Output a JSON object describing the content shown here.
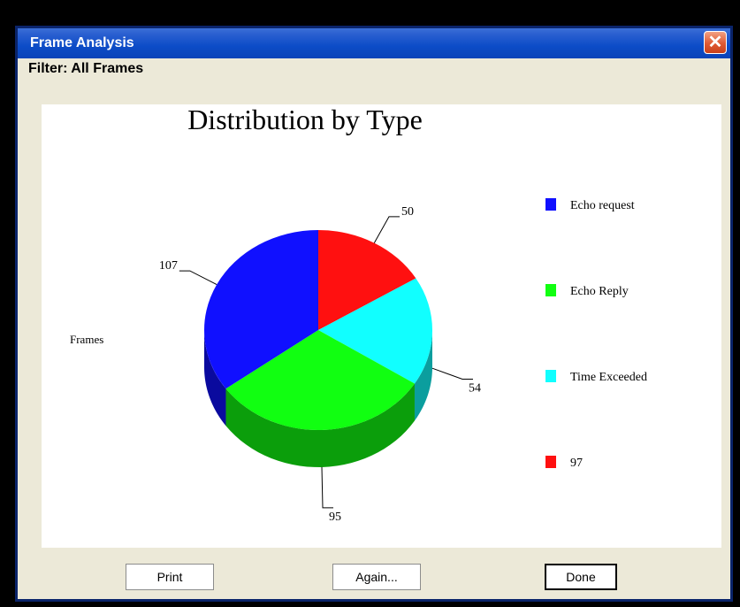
{
  "window": {
    "title": "Frame Analysis",
    "close_symbol": "✕",
    "filter_label": "Filter: All Frames"
  },
  "buttons": {
    "print": "Print",
    "again": "Again...",
    "done": "Done"
  },
  "chart_data": {
    "type": "pie",
    "title": "Distribution by Type",
    "ylabel": "Frames",
    "slices": [
      {
        "label": "97",
        "value": 50,
        "color": "#ff1010"
      },
      {
        "label": "Time Exceeded",
        "value": 54,
        "color": "#11ffff"
      },
      {
        "label": "Echo Reply",
        "value": 95,
        "color": "#11ff11"
      },
      {
        "label": "Echo request",
        "value": 107,
        "color": "#1010ff"
      }
    ],
    "legend": [
      {
        "label": "Echo request",
        "color": "#1010ff"
      },
      {
        "label": "Echo Reply",
        "color": "#11ff11"
      },
      {
        "label": "Time Exceeded",
        "color": "#11ffff"
      },
      {
        "label": "97",
        "color": "#ff1010"
      }
    ],
    "legend_position": "right",
    "style": "3d"
  }
}
